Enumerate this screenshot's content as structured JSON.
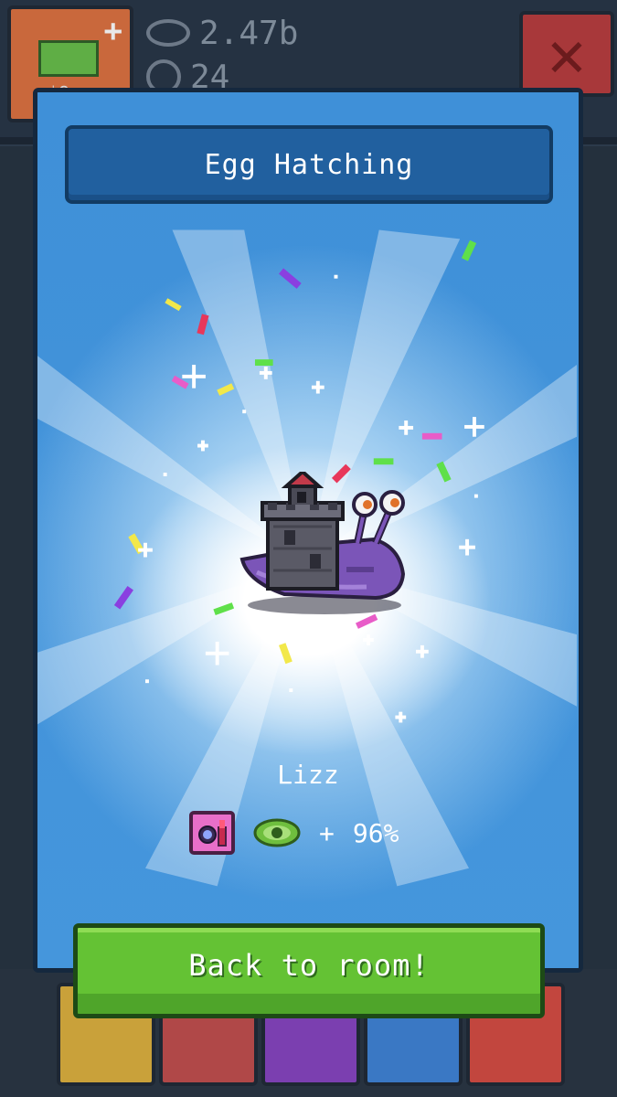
{
  "hud": {
    "views_value": "2.47b",
    "coins_value": "24",
    "cash_sub": "$8"
  },
  "dialog": {
    "title": "Egg Hatching",
    "pet_name": "Lizz",
    "bonus_prefix": "+",
    "bonus_value": "96%",
    "category_icon": "makeup-icon",
    "bonus_icon": "views-eye-icon"
  },
  "actions": {
    "back_label": "Back to room!"
  },
  "colors": {
    "dialog_blue": "#3f90d8",
    "title_bar": "#21609f",
    "button_green": "#64c234",
    "category_pink": "#e86fc9",
    "eye_green": "#6fbf3e"
  }
}
